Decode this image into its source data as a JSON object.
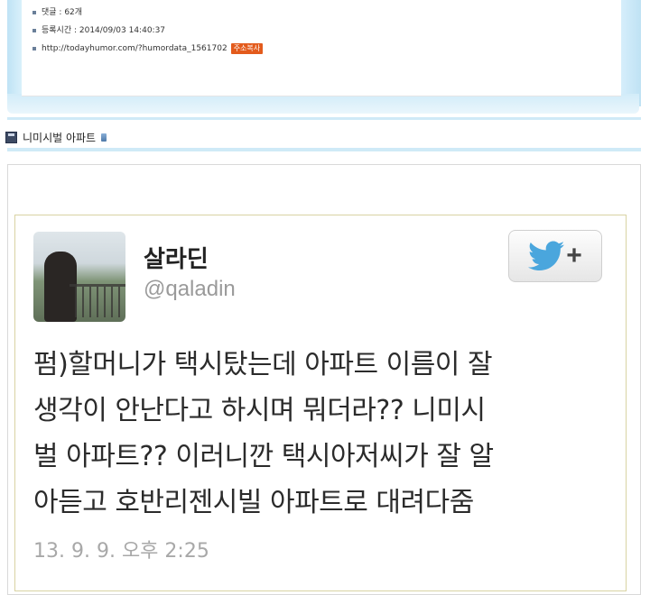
{
  "meta": {
    "comments": "댓글 : 62개",
    "registered": "등록시간 : 2014/09/03 14:40:37",
    "url": "http://todayhumor.com/?humordata_1561702",
    "copy_button": "주소복사"
  },
  "post": {
    "title": "니미시벌 아파트"
  },
  "tweet": {
    "name": "살라딘",
    "handle": "@qaladin",
    "lines": [
      "펌)할머니가 택시탔는데 아파트 이름이 잘",
      "생각이 안난다고 하시며 뭐더라?? 니미시",
      "벌 아파트?? 이러니깐 택시아저씨가 잘 알",
      "아듣고 호반리젠시빌 아파트로 대려다줌"
    ],
    "timestamp": "13. 9. 9. 오후 2:25",
    "follow_plus": "+"
  },
  "colors": {
    "frame_blue": "#cfeaf7",
    "twitter_blue": "#4aa6dd",
    "copy_button_bg": "#e35b1c"
  },
  "icons": {
    "title_icon": "floppy-disk-icon",
    "title_suffix_icon": "tag-icon",
    "follow_icon": "twitter-bird-icon"
  }
}
